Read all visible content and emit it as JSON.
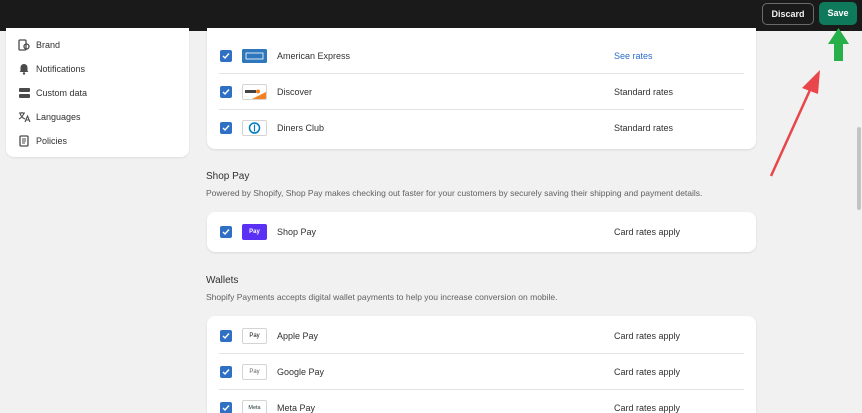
{
  "topbar": {
    "discard_label": "Discard",
    "save_label": "Save"
  },
  "sidebar": {
    "items": [
      {
        "label": "Brand",
        "icon": "brand-icon"
      },
      {
        "label": "Notifications",
        "icon": "bell-icon"
      },
      {
        "label": "Custom data",
        "icon": "database-icon"
      },
      {
        "label": "Languages",
        "icon": "translate-icon"
      },
      {
        "label": "Policies",
        "icon": "document-icon"
      }
    ]
  },
  "cards_section": {
    "rows": [
      {
        "name": "American Express",
        "rate": "See rates",
        "checked": true
      },
      {
        "name": "Discover",
        "rate": "Standard rates",
        "checked": true
      },
      {
        "name": "Diners Club",
        "rate": "Standard rates",
        "checked": true
      }
    ]
  },
  "shop_pay": {
    "title": "Shop Pay",
    "description": "Powered by Shopify, Shop Pay makes checking out faster for your customers by securely saving their shipping and payment details.",
    "rows": [
      {
        "name": "Shop Pay",
        "rate": "Card rates apply",
        "checked": true,
        "logo_text": "Pay"
      }
    ]
  },
  "wallets": {
    "title": "Wallets",
    "description": "Shopify Payments accepts digital wallet payments to help you increase conversion on mobile.",
    "rows": [
      {
        "name": "Apple Pay",
        "rate": "Card rates apply",
        "checked": true,
        "logo_text": "Pay"
      },
      {
        "name": "Google Pay",
        "rate": "Card rates apply",
        "checked": true,
        "logo_text": "Pay"
      },
      {
        "name": "Meta Pay",
        "rate": "Card rates apply",
        "checked": true,
        "logo_text": "Meta"
      }
    ]
  },
  "colors": {
    "topbar": "#1a1a1a",
    "save": "#0f7a5b",
    "checkbox": "#2f6fc4",
    "link": "#2a6ec9",
    "arrow_red": "#e8464b",
    "arrow_green": "#27b04a"
  }
}
